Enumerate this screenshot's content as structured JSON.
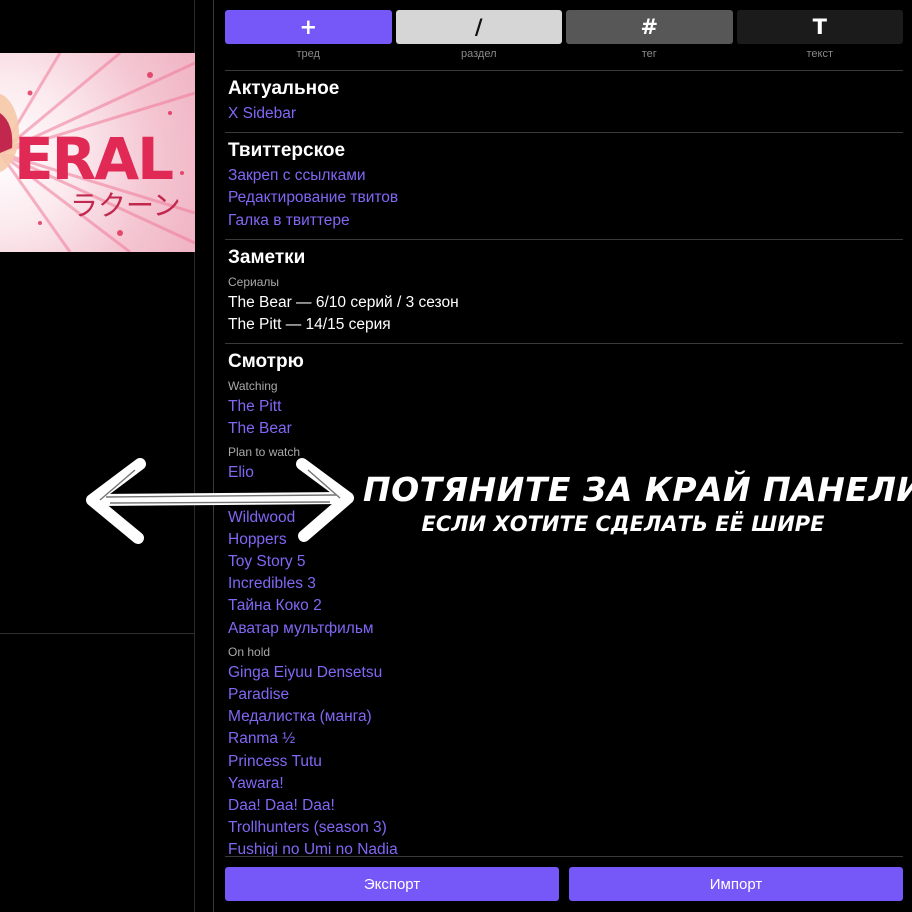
{
  "toolbar": {
    "items": [
      {
        "glyph": "+",
        "label": "тред"
      },
      {
        "glyph": "/",
        "label": "раздел"
      },
      {
        "glyph": "#",
        "label": "тег"
      },
      {
        "glyph": "T",
        "label": "текст"
      }
    ]
  },
  "banner": {
    "text_latin": "ERAL",
    "text_kana": "ラクーン"
  },
  "sections": {
    "actual": {
      "title": "Актуальное",
      "links": [
        "X Sidebar"
      ]
    },
    "twitter": {
      "title": "Твиттерское",
      "links": [
        "Закреп с ссылками",
        "Редактирование твитов",
        "Галка в твиттере"
      ]
    },
    "notes": {
      "title": "Заметки",
      "subheading": "Сериалы",
      "lines": [
        "The Bear — 6/10 серий / 3 сезон",
        "The Pitt — 14/15 серия"
      ]
    },
    "watching": {
      "title": "Смотрю",
      "groups": [
        {
          "name": "Watching",
          "items": [
            "The Pitt",
            "The Bear"
          ]
        },
        {
          "name": "Plan to watch",
          "items": [
            "Elio",
            "",
            "Wildwood",
            "Hoppers",
            "Toy Story 5",
            "Incredibles 3",
            "Тайна Коко 2",
            "Аватар мультфильм"
          ]
        },
        {
          "name": "On hold",
          "items": [
            "Ginga Eiyuu Densetsu",
            "Paradise",
            "Медалистка (манга)",
            "Ranma ½",
            "Princess Tutu",
            "Yawara!",
            "Daa! Daa! Daa!",
            "Trollhunters (season 3)",
            "Fushigi no Umi no Nadia"
          ]
        }
      ]
    }
  },
  "actions": {
    "export_label": "Экспорт",
    "import_label": "Импорт"
  },
  "hint": {
    "title": "ПОТЯНИТЕ ЗА КРАЙ ПАНЕЛИ",
    "subtitle": "ЕСЛИ ХОТИТЕ СДЕЛАТЬ ЕЁ ШИРЕ"
  },
  "colors": {
    "accent": "#7657f7",
    "link": "#8267f5",
    "banner_red": "#e02a55"
  }
}
